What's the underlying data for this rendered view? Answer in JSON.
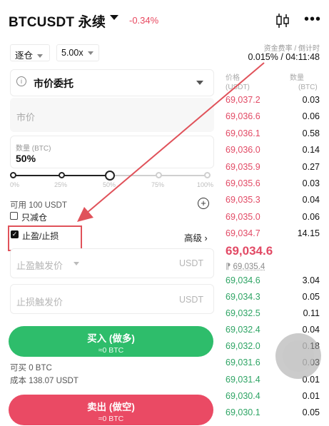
{
  "header": {
    "symbol": "BTCUSDT 永续",
    "change": "-0.34%",
    "funding_label": "资金费率 / 倒计时",
    "funding_value": "0.015% / 04:11:48"
  },
  "selectors": {
    "margin_mode": "逐仓",
    "leverage": "5.00x"
  },
  "order_form": {
    "order_type": "市价委托",
    "price_placeholder": "市价",
    "qty_label": "数量 (BTC)",
    "qty_value": "50%",
    "slider_ticks": [
      "0%",
      "25%",
      "50%",
      "75%",
      "100%"
    ],
    "slider_level": 0.5,
    "available": "可用 100 USDT",
    "reduce_only": "只减仓",
    "tpsl": "止盈/止损",
    "advanced": "高级 ›",
    "tp_label": "止盈触发价",
    "sl_label": "止损触发价",
    "unit": "USDT",
    "buy_label": "买入 (做多)",
    "buy_sub": "≈0 BTC",
    "can_buy": "可买 0 BTC",
    "cost": "成本 138.07 USDT",
    "sell_label": "卖出 (做空)",
    "sell_sub": "≈0 BTC"
  },
  "order_book": {
    "price_head": "价格",
    "price_unit": "(USDT)",
    "qty_head": "数量",
    "qty_unit": "(BTC)",
    "asks": [
      {
        "price": "69,037.2",
        "qty": "0.03"
      },
      {
        "price": "69,036.6",
        "qty": "0.06"
      },
      {
        "price": "69,036.1",
        "qty": "0.58"
      },
      {
        "price": "69,036.0",
        "qty": "0.14"
      },
      {
        "price": "69,035.9",
        "qty": "0.27"
      },
      {
        "price": "69,035.6",
        "qty": "0.03"
      },
      {
        "price": "69,035.3",
        "qty": "0.04"
      },
      {
        "price": "69,035.0",
        "qty": "0.06"
      },
      {
        "price": "69,034.7",
        "qty": "14.15"
      }
    ],
    "last_price": "69,034.6",
    "mark_price": "69,035.4",
    "bids": [
      {
        "price": "69,034.6",
        "qty": "3.04"
      },
      {
        "price": "69,034.3",
        "qty": "0.05"
      },
      {
        "price": "69,032.5",
        "qty": "0.11"
      },
      {
        "price": "69,032.4",
        "qty": "0.04"
      },
      {
        "price": "69,032.0",
        "qty": "0.18"
      },
      {
        "price": "69,031.6",
        "qty": "0.03"
      },
      {
        "price": "69,031.4",
        "qty": "0.01"
      },
      {
        "price": "69,030.4",
        "qty": "0.01"
      },
      {
        "price": "69,030.1",
        "qty": "0.05"
      }
    ]
  }
}
